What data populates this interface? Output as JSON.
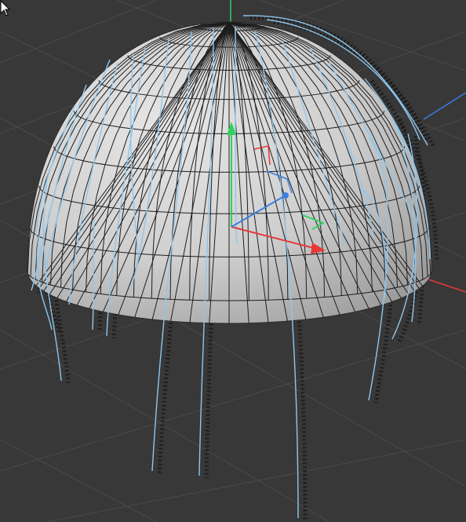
{
  "viewport": {
    "background_color": "#383838",
    "grid_color": "#4a4a4a"
  },
  "object": {
    "type": "hemisphere",
    "surface_color": "#cfcfcf",
    "wire_color": "#1e1e1e"
  },
  "guides": {
    "color": "#8fc6ee",
    "shadow_color": "#1a1a1a"
  },
  "gizmo": {
    "x_axis_color": "#e53a3a",
    "y_axis_color": "#2fd15a",
    "z_axis_color": "#3b7fe0",
    "x_handle_label": "",
    "y_handle_label": "",
    "z_handle_label": ""
  },
  "cursor": {
    "icon": "arrow-pointer-icon"
  }
}
